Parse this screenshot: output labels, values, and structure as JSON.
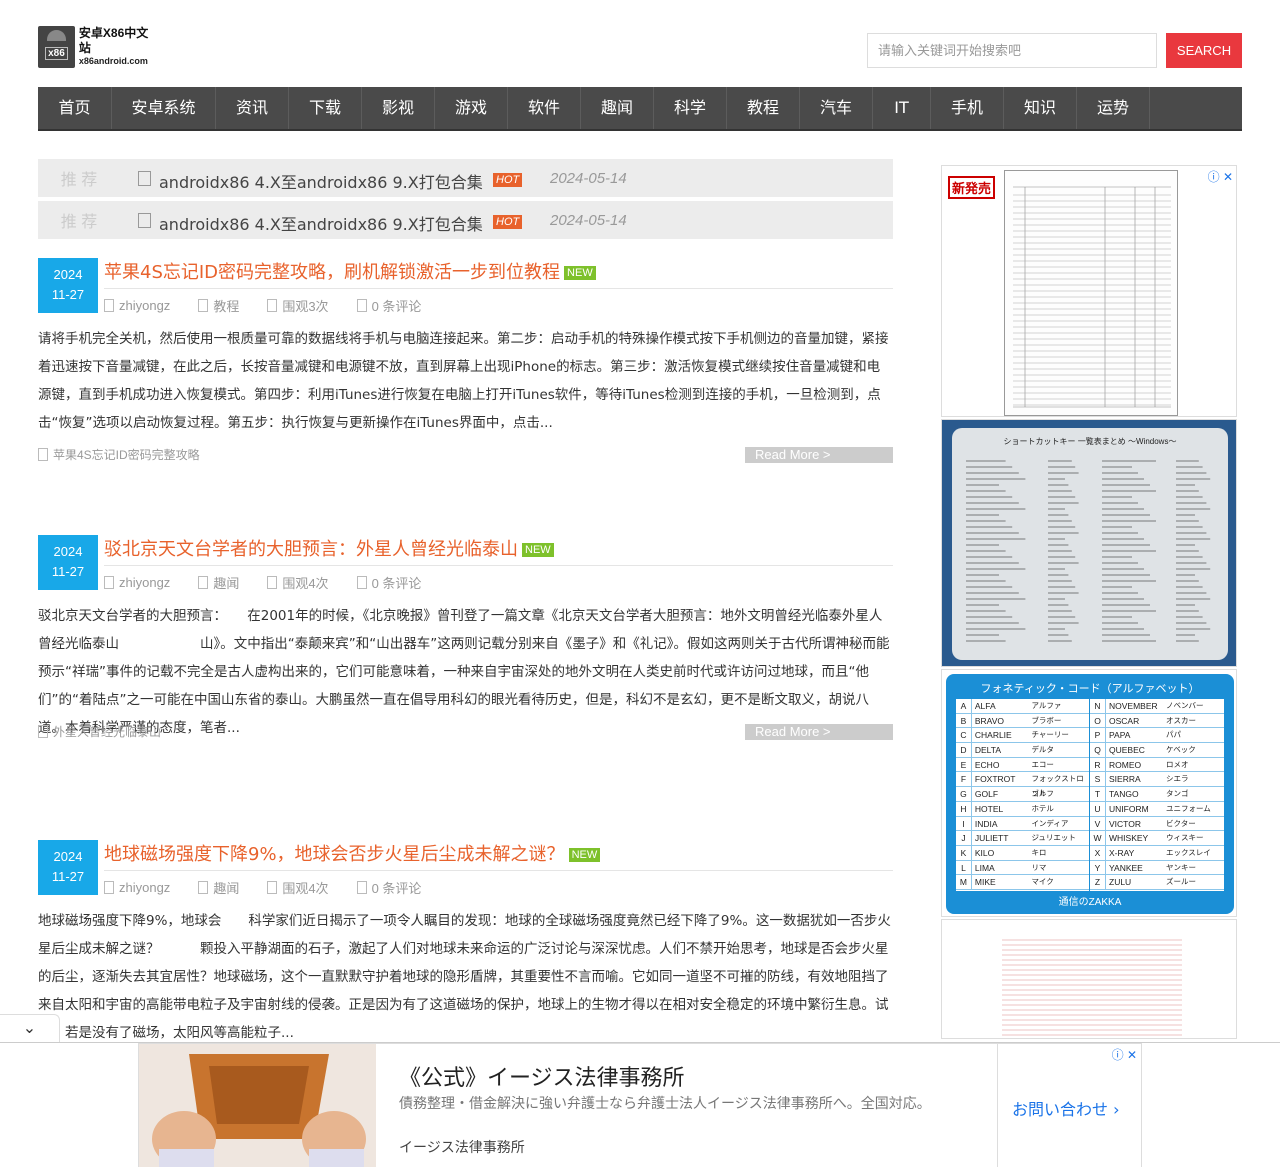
{
  "site": {
    "logo_badge": "x86",
    "name": "安卓X86中文站",
    "domain": "x86android.com"
  },
  "search": {
    "placeholder": "请输入关键词开始搜索吧",
    "button": "SEARCH"
  },
  "nav": [
    {
      "label": "首页",
      "w": 74
    },
    {
      "label": "安卓系统",
      "w": 104
    },
    {
      "label": "资讯",
      "w": 73
    },
    {
      "label": "下载",
      "w": 73
    },
    {
      "label": "影视",
      "w": 73
    },
    {
      "label": "游戏",
      "w": 73
    },
    {
      "label": "软件",
      "w": 73
    },
    {
      "label": "趣闻",
      "w": 73
    },
    {
      "label": "科学",
      "w": 73
    },
    {
      "label": "教程",
      "w": 73
    },
    {
      "label": "汽车",
      "w": 73
    },
    {
      "label": "IT",
      "w": 58
    },
    {
      "label": "手机",
      "w": 73
    },
    {
      "label": "知识",
      "w": 73
    },
    {
      "label": "运势",
      "w": 73
    }
  ],
  "recommended": [
    {
      "label": "推 荐",
      "title": "androidx86 4.X至androidx86 9.X打包合集",
      "badge": "HOT",
      "date": "2024-05-14"
    },
    {
      "label": "推 荐",
      "title": "androidx86 4.X至androidx86 9.X打包合集",
      "badge": "HOT",
      "date": "2024-05-14"
    }
  ],
  "posts": [
    {
      "year": "2024",
      "day": "11-27",
      "title": "苹果4S忘记ID密码完整攻略，刷机解锁激活一步到位教程",
      "badge": "NEW",
      "author": "zhiyongz",
      "category": "教程",
      "views": "围观3次",
      "comments": "0 条评论",
      "excerpt": "请将手机完全关机，然后使用一根质量可靠的数据线将手机与电脑连接起来。第二步：启动手机的特殊操作模式按下手机侧边的音量加键，紧接着迅速按下音量减键，在此之后，长按音量减键和电源键不放，直到屏幕上出现iPhone的标志。第三步：激活恢复模式继续按住音量减键和电源键，直到手机成功进入恢复模式。第四步：利用iTunes进行恢复在电脑上打开iTunes软件，等待iTunes检测到连接的手机，一旦检测到，点击“恢复”选项以启动恢复过程。第五步：执行恢复与更新操作在iTunes界面中，点击...",
      "tag": "苹果4S忘记ID密码完整攻略",
      "read_more": "Read More >"
    },
    {
      "year": "2024",
      "day": "11-27",
      "title": "驳北京天文台学者的大胆预言：外星人曾经光临泰山",
      "badge": "NEW",
      "author": "zhiyongz",
      "category": "趣闻",
      "views": "围观4次",
      "comments": "0 条评论",
      "excerpt": "驳北京天文台学者的大胆预言：　　在2001年的时候，《北京晚报》曾刊登了一篇文章《北京天文台学者大胆预言：地外文明曾经光临泰外星人曾经光临泰山　　　　　　山》。文中指出“泰颠来宾”和“山出器车”这两则记载分别来自《墨子》和《礼记》。假如这两则关于古代所谓神秘而能预示“祥瑞”事件的记载不完全是古人虚构出来的，它们可能意味着，一种来自宇宙深处的地外文明在人类史前时代或许访问过地球，而且“他们”的“着陆点”之一可能在中国山东省的泰山。大鹏虽然一直在倡导用科幻的眼光看待历史，但是，科幻不是玄幻，更不是断文取义，胡说八道。本着科学严谨的态度，笔者...",
      "tag": "外星人曾经光临泰山",
      "read_more": "Read More >"
    },
    {
      "year": "2024",
      "day": "11-27",
      "title": "地球磁场强度下降9%，地球会否步火星后尘成未解之谜？",
      "badge": "NEW",
      "author": "zhiyongz",
      "category": "趣闻",
      "views": "围观4次",
      "comments": "0 条评论",
      "excerpt": "地球磁场强度下降9%，地球会　　科学家们近日揭示了一项令人瞩目的发现：地球的全球磁场强度竟然已经下降了9%。这一数据犹如一否步火星后尘成未解之谜？　　　颗投入平静湖面的石子，激起了人们对地球未来命运的广泛讨论与深深忧虑。人们不禁开始思考，地球是否会步火星的后尘，逐渐失去其宜居性？地球磁场，这个一直默默守护着地球的隐形盾牌，其重要性不言而喻。它如同一道坚不可摧的防线，有效地阻挡了来自太阳和宇宙的高能带电粒子及宇宙射线的侵袭。正是因为有了这道磁场的保护，地球上的生物才得以在相对安全稳定的环境中繁衍生息。试想，若是没有了磁场，太阳风等高能粒子...",
      "tag": "",
      "read_more": "Read More >"
    }
  ],
  "sidebar_ads": [
    {
      "badge": "新発売",
      "kind": "document"
    },
    {
      "heading": "ショートカットキー 一覧表まとめ ～Windows～",
      "kind": "shortcut-card"
    },
    {
      "heading": "フォネティック・コード（アルファベット）",
      "footer": "通信のZAKKA",
      "left": [
        [
          "A",
          "ALFA",
          "アルファ"
        ],
        [
          "B",
          "BRAVO",
          "ブラボー"
        ],
        [
          "C",
          "CHARLIE",
          "チャーリー"
        ],
        [
          "D",
          "DELTA",
          "デルタ"
        ],
        [
          "E",
          "ECHO",
          "エコー"
        ],
        [
          "F",
          "FOXTROT",
          "フォックストロット"
        ],
        [
          "G",
          "GOLF",
          "ゴルフ"
        ],
        [
          "H",
          "HOTEL",
          "ホテル"
        ],
        [
          "I",
          "INDIA",
          "インディア"
        ],
        [
          "J",
          "JULIETT",
          "ジュリエット"
        ],
        [
          "K",
          "KILO",
          "キロ"
        ],
        [
          "L",
          "LIMA",
          "リマ"
        ],
        [
          "M",
          "MIKE",
          "マイク"
        ]
      ],
      "right": [
        [
          "N",
          "NOVEMBER",
          "ノベンバー"
        ],
        [
          "O",
          "OSCAR",
          "オスカー"
        ],
        [
          "P",
          "PAPA",
          "パパ"
        ],
        [
          "Q",
          "QUEBEC",
          "ケベック"
        ],
        [
          "R",
          "ROMEO",
          "ロメオ"
        ],
        [
          "S",
          "SIERRA",
          "シエラ"
        ],
        [
          "T",
          "TANGO",
          "タンゴ"
        ],
        [
          "U",
          "UNIFORM",
          "ユニフォーム"
        ],
        [
          "V",
          "VICTOR",
          "ビクター"
        ],
        [
          "W",
          "WHISKEY",
          "ウィスキー"
        ],
        [
          "X",
          "X-RAY",
          "エックスレイ"
        ],
        [
          "Y",
          "YANKEE",
          "ヤンキー"
        ],
        [
          "Z",
          "ZULU",
          "ズールー"
        ]
      ]
    },
    {
      "kind": "document-red"
    }
  ],
  "ad_choice_icons": "ⓘ ✕",
  "bottom_ad": {
    "title": "《公式》イージス法律事務所",
    "description": "債務整理・借金解決に強い弁護士なら弁護士法人イージス法律事務所へ。全国対応。",
    "advertiser": "イージス法律事務所",
    "cta": "お問い合わせ ›"
  },
  "collapse_icon": "⌄"
}
